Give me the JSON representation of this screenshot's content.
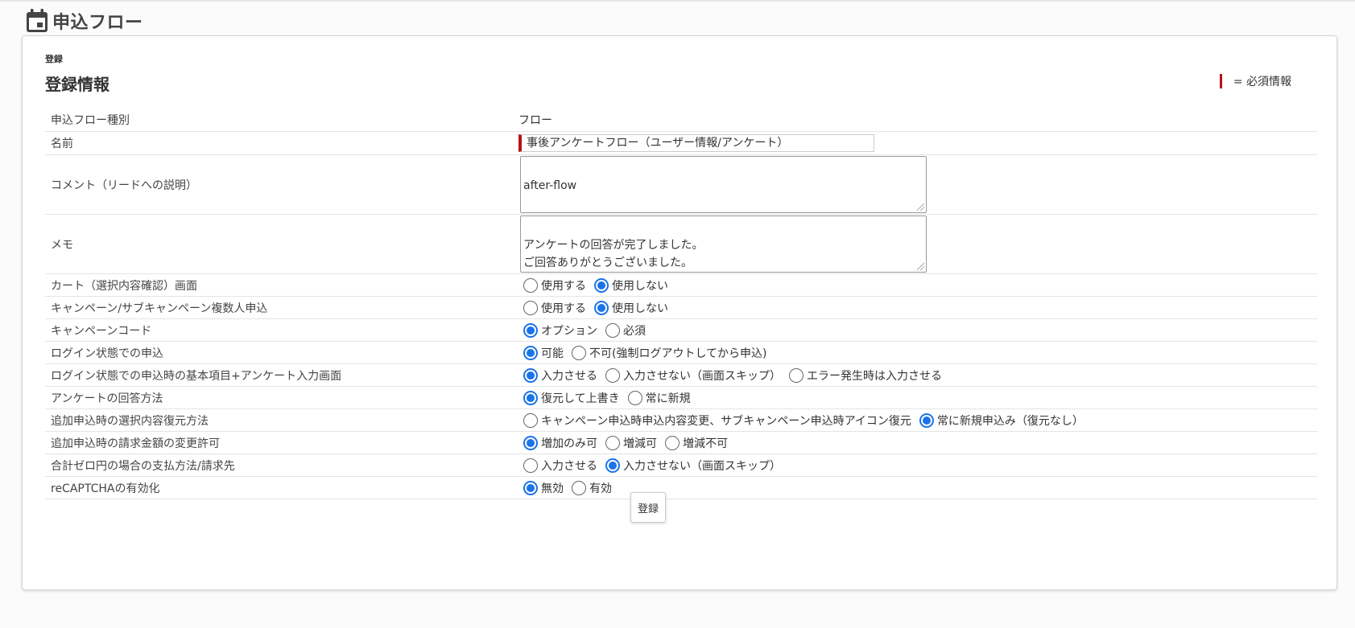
{
  "header": {
    "title": "申込フロー"
  },
  "breadcrumb": "登録",
  "section_title": "登録情報",
  "legend": {
    "text": "= 必須情報"
  },
  "form": {
    "flow_type": {
      "label": "申込フロー種別",
      "value": "フロー"
    },
    "name": {
      "label": "名前",
      "value": "事後アンケートフロー（ユーザー情報/アンケート）"
    },
    "comment": {
      "label": "コメント（リードへの説明）",
      "value": "after-flow"
    },
    "memo": {
      "label": "メモ",
      "value": "アンケートの回答が完了しました。\nご回答ありがとうございました。"
    },
    "radios": [
      {
        "label": "カート（選択内容確認）画面",
        "options": [
          "使用する",
          "使用しない"
        ],
        "selected": 1
      },
      {
        "label": "キャンペーン/サブキャンペーン複数人申込",
        "options": [
          "使用する",
          "使用しない"
        ],
        "selected": 1
      },
      {
        "label": "キャンペーンコード",
        "options": [
          "オプション",
          "必須"
        ],
        "selected": 0
      },
      {
        "label": "ログイン状態での申込",
        "options": [
          "可能",
          "不可(強制ログアウトしてから申込)"
        ],
        "selected": 0
      },
      {
        "label": "ログイン状態での申込時の基本項目+アンケート入力画面",
        "options": [
          "入力させる",
          "入力させない（画面スキップ）",
          "エラー発生時は入力させる"
        ],
        "selected": 0
      },
      {
        "label": "アンケートの回答方法",
        "options": [
          "復元して上書き",
          "常に新規"
        ],
        "selected": 0
      },
      {
        "label": "追加申込時の選択内容復元方法",
        "options": [
          "キャンペーン申込時申込内容変更、サブキャンペーン申込時アイコン復元",
          "常に新規申込み（復元なし）"
        ],
        "selected": 1
      },
      {
        "label": "追加申込時の請求金額の変更許可",
        "options": [
          "増加のみ可",
          "増減可",
          "増減不可"
        ],
        "selected": 0
      },
      {
        "label": "合計ゼロ円の場合の支払方法/請求先",
        "options": [
          "入力させる",
          "入力させない（画面スキップ）"
        ],
        "selected": 1
      },
      {
        "label": "reCAPTCHAの有効化",
        "options": [
          "無効",
          "有効"
        ],
        "selected": 0
      }
    ]
  },
  "submit_label": "登録",
  "colors": {
    "accent": "#1a73e8",
    "required_marker": "#b5121b"
  },
  "icons": {
    "header": "calendar-icon"
  }
}
